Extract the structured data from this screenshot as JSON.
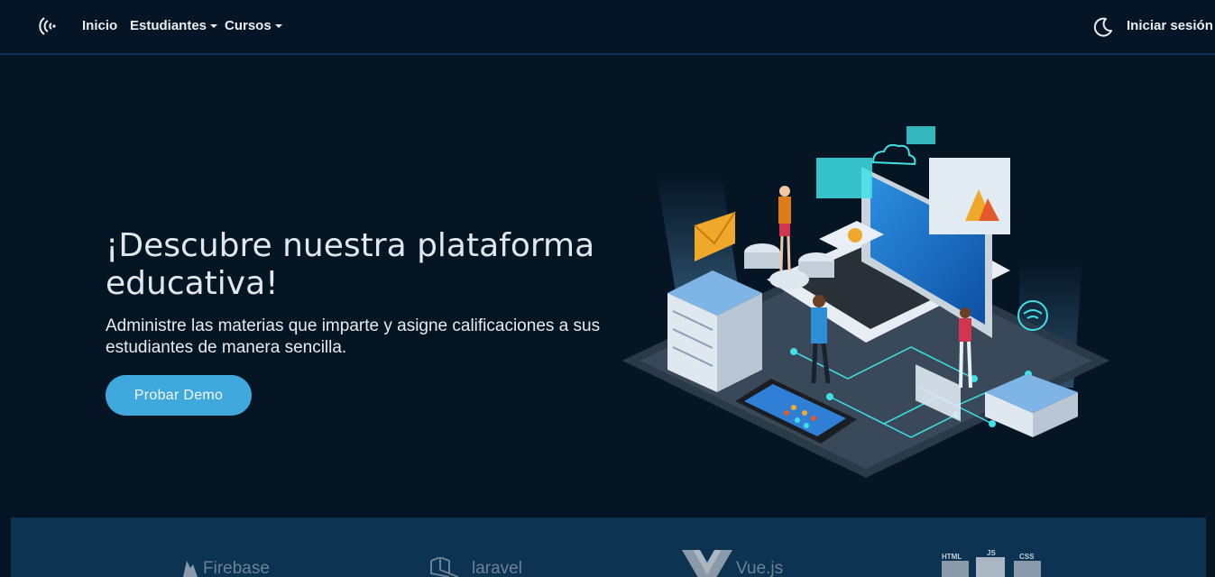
{
  "nav": {
    "logo_icon": "wave-signal-logo",
    "items": [
      {
        "label": "Inicio",
        "dropdown": false
      },
      {
        "label": "Estudiantes",
        "dropdown": true
      },
      {
        "label": "Cursos",
        "dropdown": true
      }
    ],
    "theme_toggle_icon": "moon-icon",
    "login_label": "Iniciar sesión"
  },
  "hero": {
    "title": "¡Descubre nuestra plataforma educativa!",
    "subtitle": "Administre las materias que imparte y asigne calificaciones a sus estudiantes de manera sencilla.",
    "cta_label": "Probar Demo",
    "illustration_icon": "isometric-laptop-servers-illustration"
  },
  "brands": [
    {
      "name": "Firebase",
      "icon": "firebase-icon"
    },
    {
      "name": "laravel",
      "icon": "laravel-icon"
    },
    {
      "name": "Vue.js",
      "icon": "vue-icon"
    },
    {
      "name": "HTML JS CSS",
      "icon": "html-js-css-icon"
    }
  ],
  "colors": {
    "background": "#061524",
    "accent": "#3fa9dd",
    "band": "#0d3352"
  }
}
